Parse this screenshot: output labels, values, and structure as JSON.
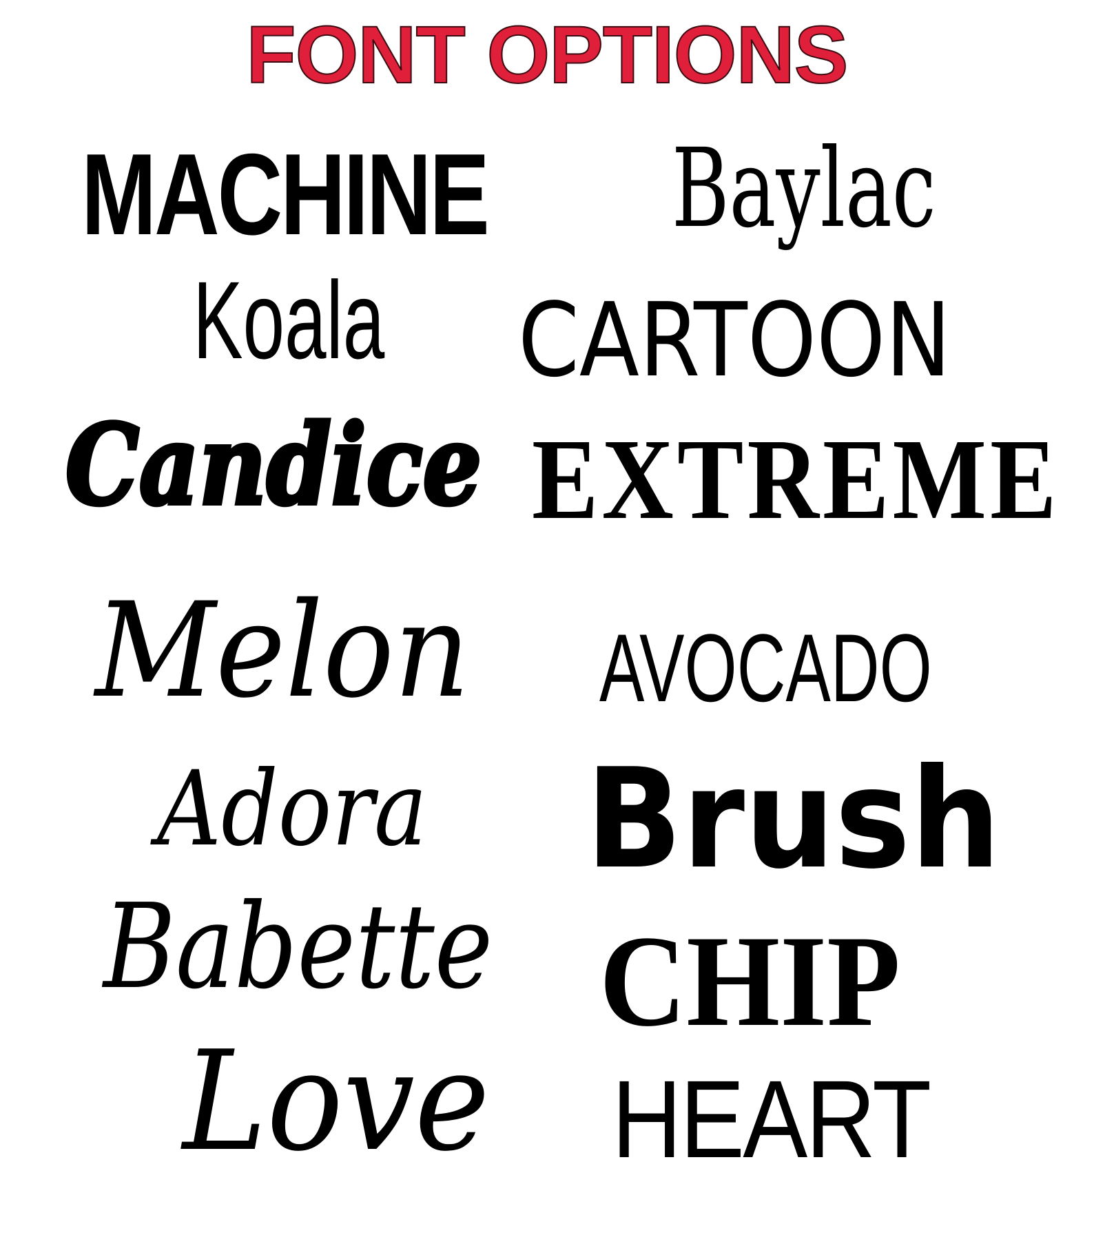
{
  "title": {
    "text": "FONT OPTIONS",
    "color": "#e0203a"
  },
  "fonts": [
    "MACHINE",
    "Baylac",
    "Koala",
    "CARTOON",
    "Candice",
    "EXTREME",
    "Melon",
    "AVOCADO",
    "Adora",
    "Brush",
    "Babette",
    "CHIP",
    "Love",
    "HEART"
  ]
}
